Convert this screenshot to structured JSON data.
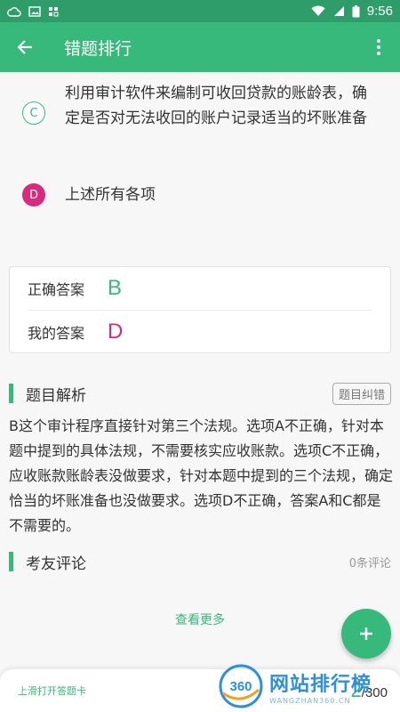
{
  "status": {
    "time": "9:56"
  },
  "app_bar": {
    "title": "错题排行"
  },
  "options": [
    {
      "letter": "C",
      "text": "利用审计软件来编制可收回贷款的账龄表，确定是否对无法收回的账户记录适当的坏账准备"
    },
    {
      "letter": "D",
      "text": "上述所有各项"
    }
  ],
  "answers": {
    "correct_label": "正确答案",
    "correct_value": "B",
    "mine_label": "我的答案",
    "mine_value": "D"
  },
  "analysis": {
    "title": "题目解析",
    "report_label": "题目纠错",
    "text": "B这个审计程序直接针对第三个法规。选项A不正确，针对本题中提到的具体法规，不需要核实应收账款。选项C不正确，应收账款账龄表没做要求，针对本题中提到的三个法规，确定恰当的坏账准备也没做要求。选项D不正确，答案A和C都是不需要的。"
  },
  "comments": {
    "title": "考友评论",
    "count": "0条评论",
    "more": "查看更多"
  },
  "bottom": {
    "hint": "上滑打开答题卡",
    "current": "2",
    "total": "/300"
  },
  "watermark": {
    "badge": "360",
    "title": "网站排行榜",
    "sub": "WANGZHAN360.CN"
  },
  "colors": {
    "primary": "#37b97b",
    "status_bar": "#2f9d6a",
    "wrong": "#d92a7e"
  }
}
